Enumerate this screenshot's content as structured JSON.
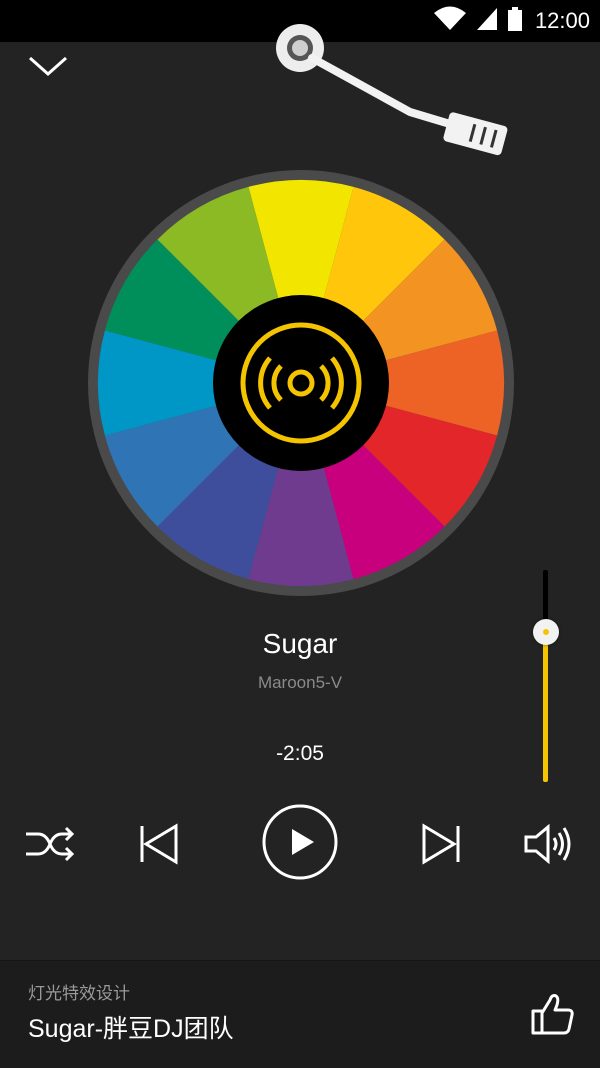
{
  "status_bar": {
    "time": "12:00",
    "icons": [
      "wifi-icon",
      "signal-icon",
      "battery-icon"
    ]
  },
  "player": {
    "song_title": "Sugar",
    "artist": "Maroon5-V",
    "time_remaining": "-2:05",
    "volume_level": 0.71
  },
  "controls": {
    "shuffle_icon": "shuffle-icon",
    "previous_icon": "previous-icon",
    "play_icon": "play-icon",
    "next_icon": "next-icon",
    "volume_icon": "volume-icon"
  },
  "credit": {
    "label": "灯光特效设计",
    "title": "Sugar-胖豆DJ团队",
    "like_icon": "thumbs-up-icon"
  },
  "colors": {
    "accent": "#f5c400",
    "background": "#232323",
    "wheel": [
      "#f2e600",
      "#ffc60b",
      "#f39321",
      "#ec6325",
      "#e3262a",
      "#c8007d",
      "#6f3b8f",
      "#3f4e9c",
      "#2f74b5",
      "#0096c6",
      "#008f5a",
      "#8cba25"
    ]
  }
}
